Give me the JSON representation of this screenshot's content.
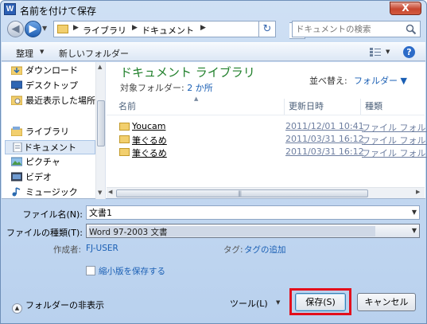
{
  "window": {
    "app_icon": "W",
    "title": "名前を付けて保存",
    "close_label": "X"
  },
  "address": {
    "crumbs": [
      "ライブラリ",
      "ドキュメント"
    ],
    "search_placeholder": "ドキュメントの検索"
  },
  "toolbar": {
    "organize_label": "整理",
    "new_folder_label": "新しいフォルダー"
  },
  "nav": {
    "items": [
      {
        "label": "ダウンロード",
        "icon": "download-folder-icon"
      },
      {
        "label": "デスクトップ",
        "icon": "desktop-icon"
      },
      {
        "label": "最近表示した場所",
        "icon": "recent-places-icon"
      },
      {
        "label": "ライブラリ",
        "icon": "libraries-icon"
      },
      {
        "label": "ドキュメント",
        "icon": "documents-icon",
        "selected": true
      },
      {
        "label": "ピクチャ",
        "icon": "pictures-icon"
      },
      {
        "label": "ビデオ",
        "icon": "videos-icon"
      },
      {
        "label": "ミュージック",
        "icon": "music-icon"
      }
    ]
  },
  "library": {
    "title": "ドキュメント ライブラリ",
    "subtitle_prefix": "対象フォルダー: ",
    "subtitle_link": "2 か所",
    "arrange_label": "並べ替え:",
    "arrange_value": "フォルダー ▼"
  },
  "columns": {
    "name": "名前",
    "date": "更新日時",
    "type": "種類"
  },
  "files": [
    {
      "name": "Youcam",
      "date": "2011/12/01 10:41",
      "type": "ファイル フォル..."
    },
    {
      "name": "筆ぐるめ",
      "date": "2011/03/31 16:12",
      "type": "ファイル フォル..."
    },
    {
      "name": "筆ぐるめ",
      "date": "2011/03/31 16:12",
      "type": "ファイル フォル..."
    }
  ],
  "form": {
    "filename_label": "ファイル名(N):",
    "filename_value": "文書1",
    "filetype_label": "ファイルの種類(T):",
    "filetype_value": "Word 97-2003 文書",
    "author_label": "作成者:",
    "author_value": "FJ-USER",
    "tags_label": "タグ:",
    "tags_value": "タグの追加",
    "thumbnail_label": "縮小版を保存する"
  },
  "footer": {
    "hide_folders_label": "フォルダーの非表示",
    "tools_label": "ツール(L)",
    "save_label": "保存(S)",
    "cancel_label": "キャンセル"
  },
  "colors": {
    "highlight": "#e30f1c",
    "library_title": "#1f7f2a",
    "link": "#1a5fb4"
  }
}
